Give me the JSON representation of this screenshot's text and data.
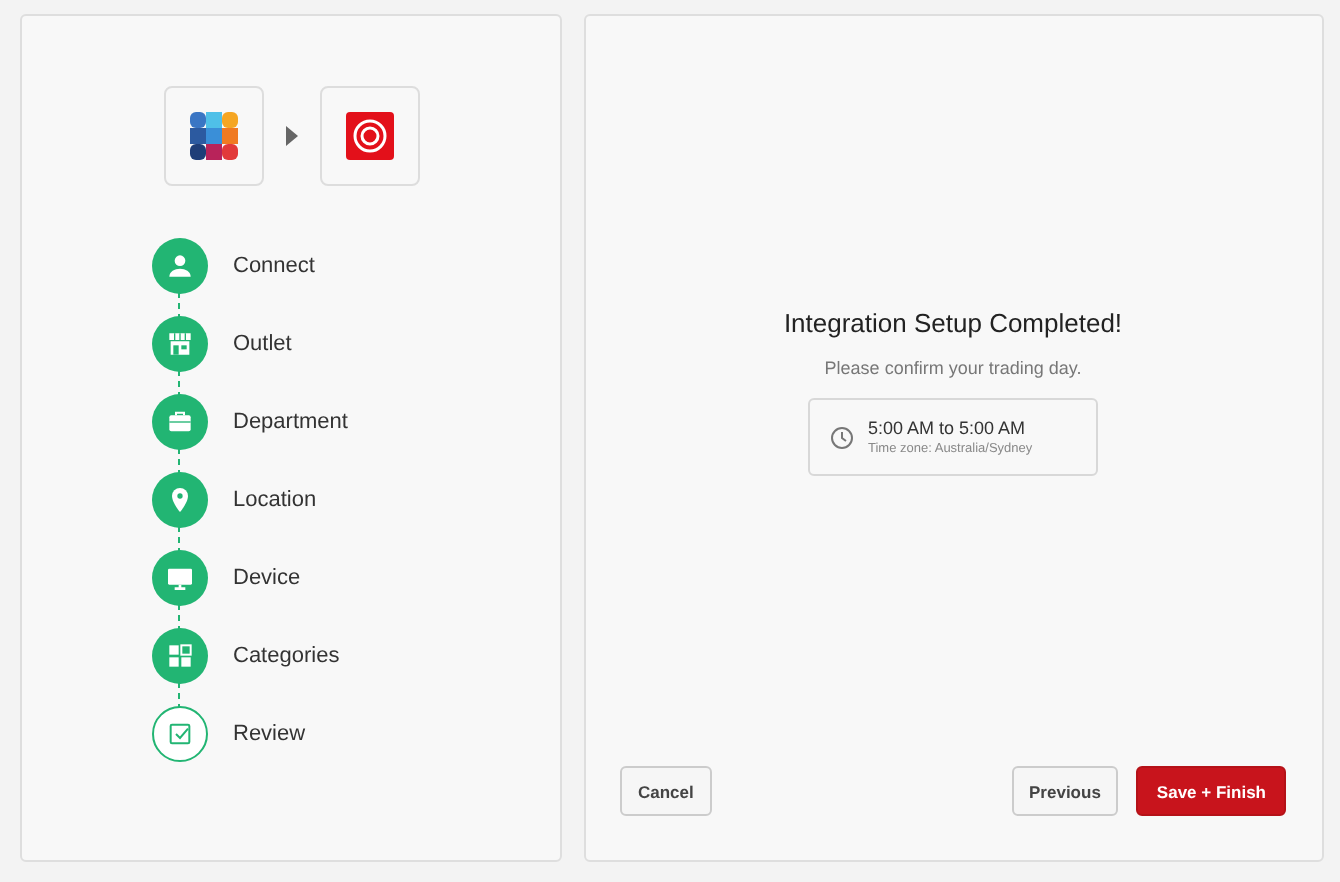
{
  "steps": [
    {
      "label": "Connect",
      "kind": "person",
      "done": true
    },
    {
      "label": "Outlet",
      "kind": "store",
      "done": true
    },
    {
      "label": "Department",
      "kind": "briefcase",
      "done": true
    },
    {
      "label": "Location",
      "kind": "pin",
      "done": true
    },
    {
      "label": "Device",
      "kind": "monitor",
      "done": true
    },
    {
      "label": "Categories",
      "kind": "grid",
      "done": true
    },
    {
      "label": "Review",
      "kind": "check",
      "done": false
    }
  ],
  "completion": {
    "title": "Integration Setup Completed!",
    "subtitle": "Please confirm your trading day.",
    "hours": "5:00 AM to 5:00 AM",
    "timezone": "Time zone: Australia/Sydney"
  },
  "buttons": {
    "cancel": "Cancel",
    "previous": "Previous",
    "finish": "Save + Finish"
  }
}
